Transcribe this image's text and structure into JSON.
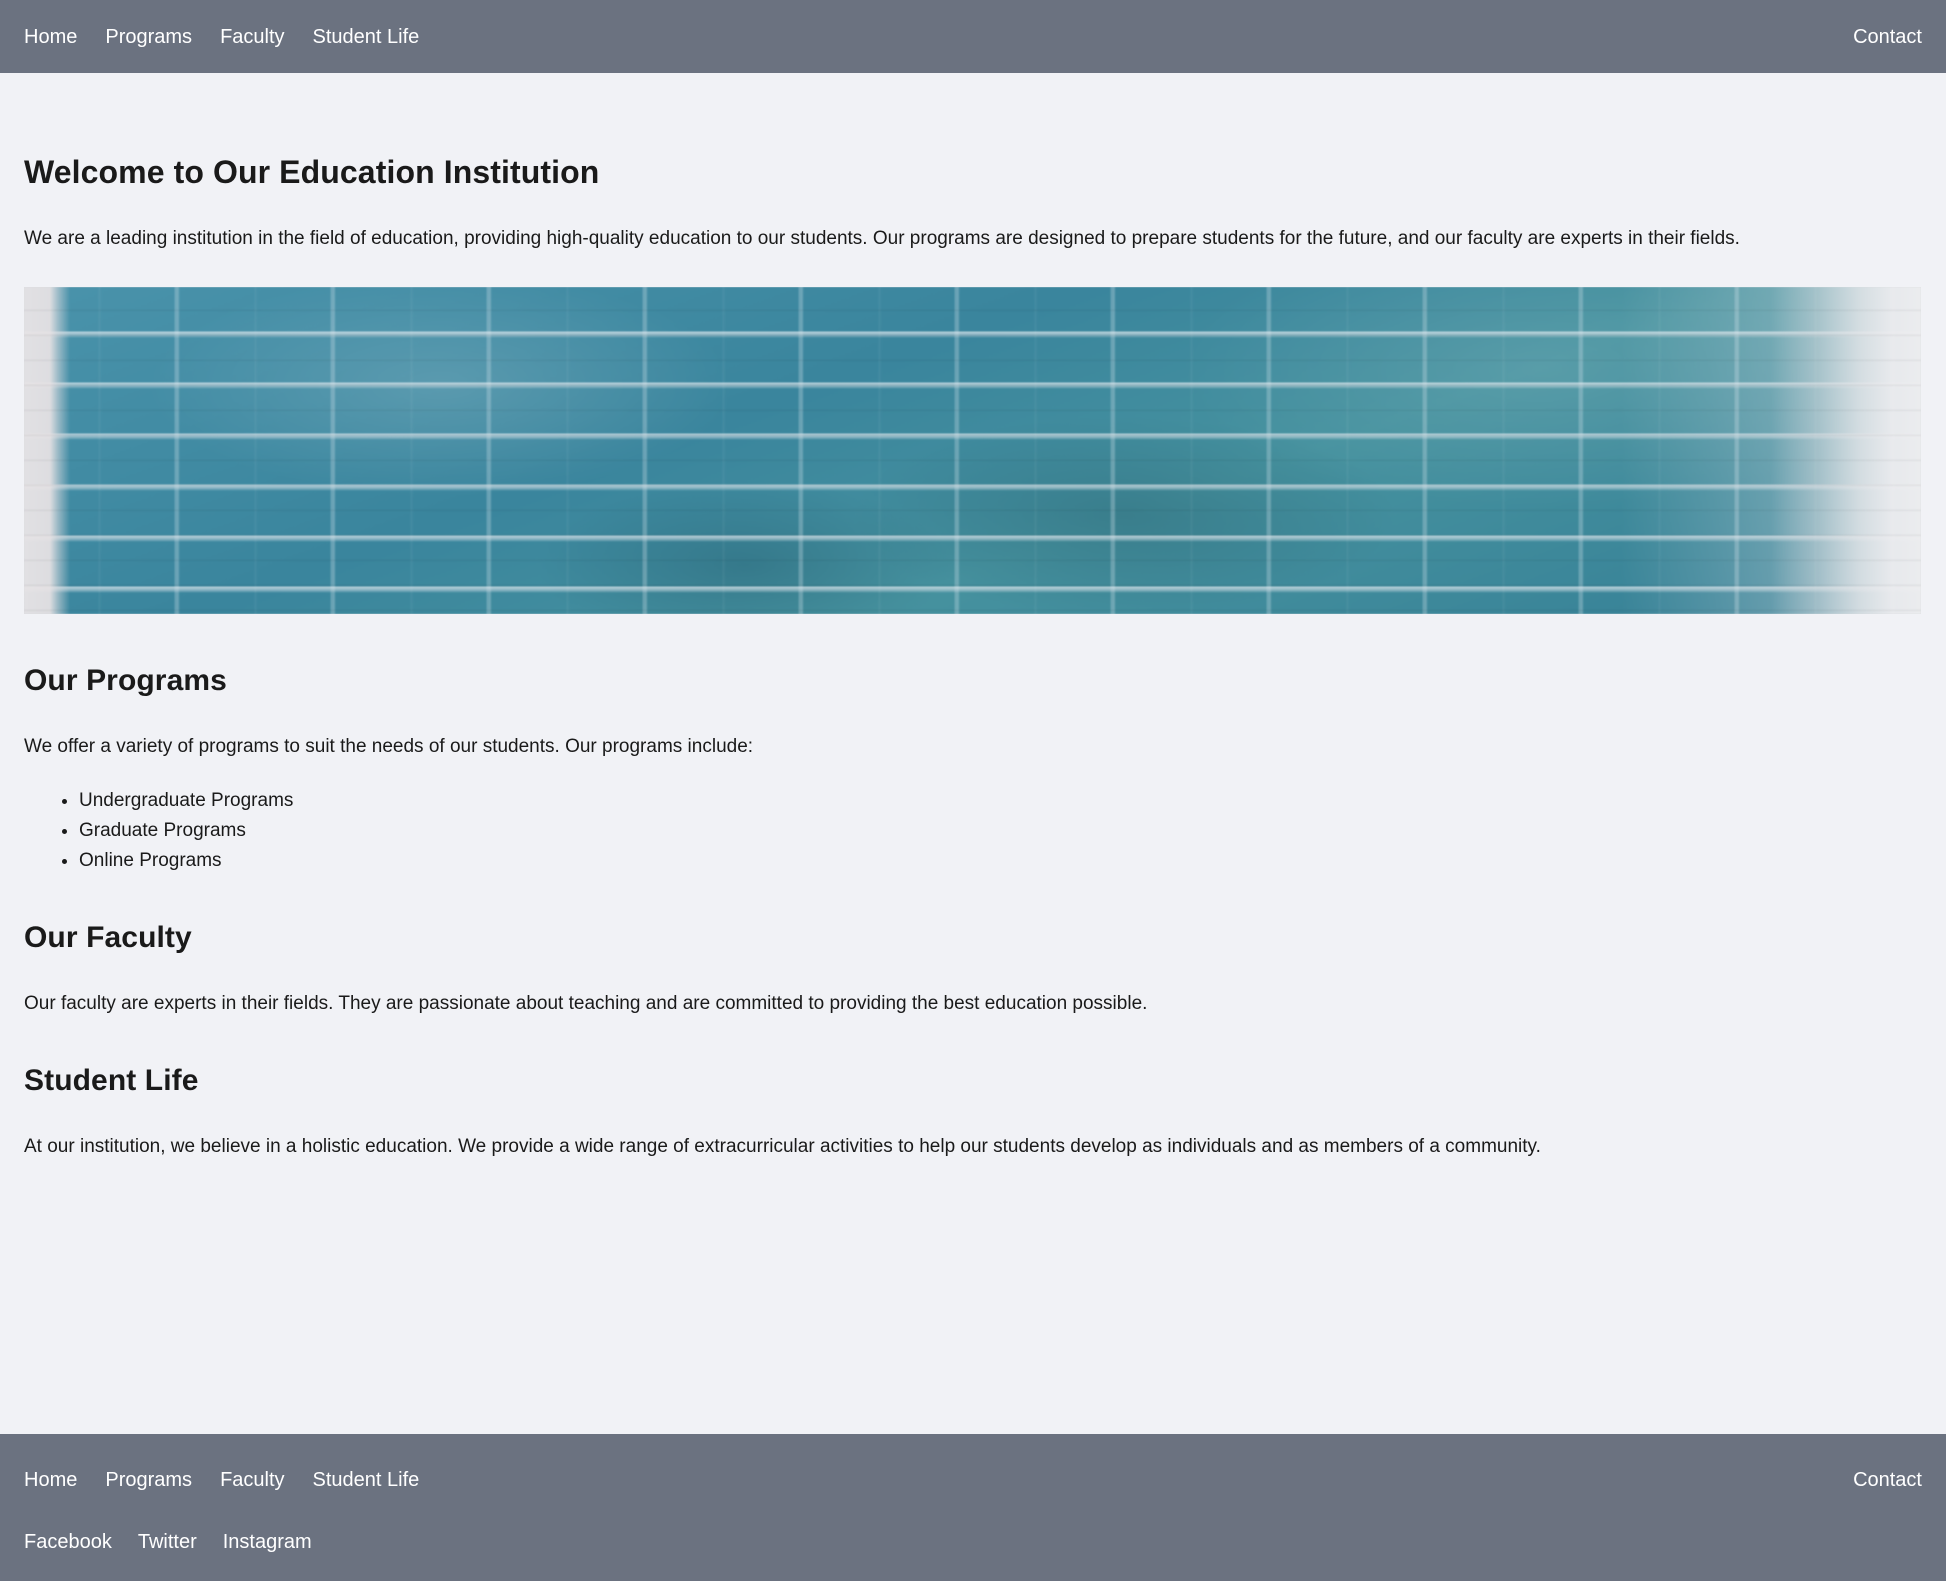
{
  "theme": {
    "bar_color": "#6b7280",
    "page_background": "#f1f2f6",
    "text_color": "#1a1a1a",
    "bar_text_color": "#ffffff",
    "hero_image_accent": "#3f8ca6"
  },
  "navbar": {
    "links": [
      {
        "label": "Home"
      },
      {
        "label": "Programs"
      },
      {
        "label": "Faculty"
      },
      {
        "label": "Student Life"
      }
    ],
    "contact_label": "Contact"
  },
  "main": {
    "hero": {
      "title": "Welcome to Our Education Institution",
      "intro": "We are a leading institution in the field of education, providing high-quality education to our students. Our programs are designed to prepare students for the future, and our faculty are experts in their fields.",
      "image_alt": "teal painted brick wall"
    },
    "programs": {
      "title": "Our Programs",
      "intro": "We offer a variety of programs to suit the needs of our students. Our programs include:",
      "items": [
        "Undergraduate Programs",
        "Graduate Programs",
        "Online Programs"
      ]
    },
    "faculty": {
      "title": "Our Faculty",
      "body": "Our faculty are experts in their fields. They are passionate about teaching and are committed to providing the best education possible."
    },
    "student_life": {
      "title": "Student Life",
      "body": "At our institution, we believe in a holistic education. We provide a wide range of extracurricular activities to help our students develop as individuals and as members of a community."
    }
  },
  "footer": {
    "links": [
      {
        "label": "Home"
      },
      {
        "label": "Programs"
      },
      {
        "label": "Faculty"
      },
      {
        "label": "Student Life"
      }
    ],
    "contact_label": "Contact",
    "social": [
      {
        "label": "Facebook"
      },
      {
        "label": "Twitter"
      },
      {
        "label": "Instagram"
      }
    ]
  }
}
